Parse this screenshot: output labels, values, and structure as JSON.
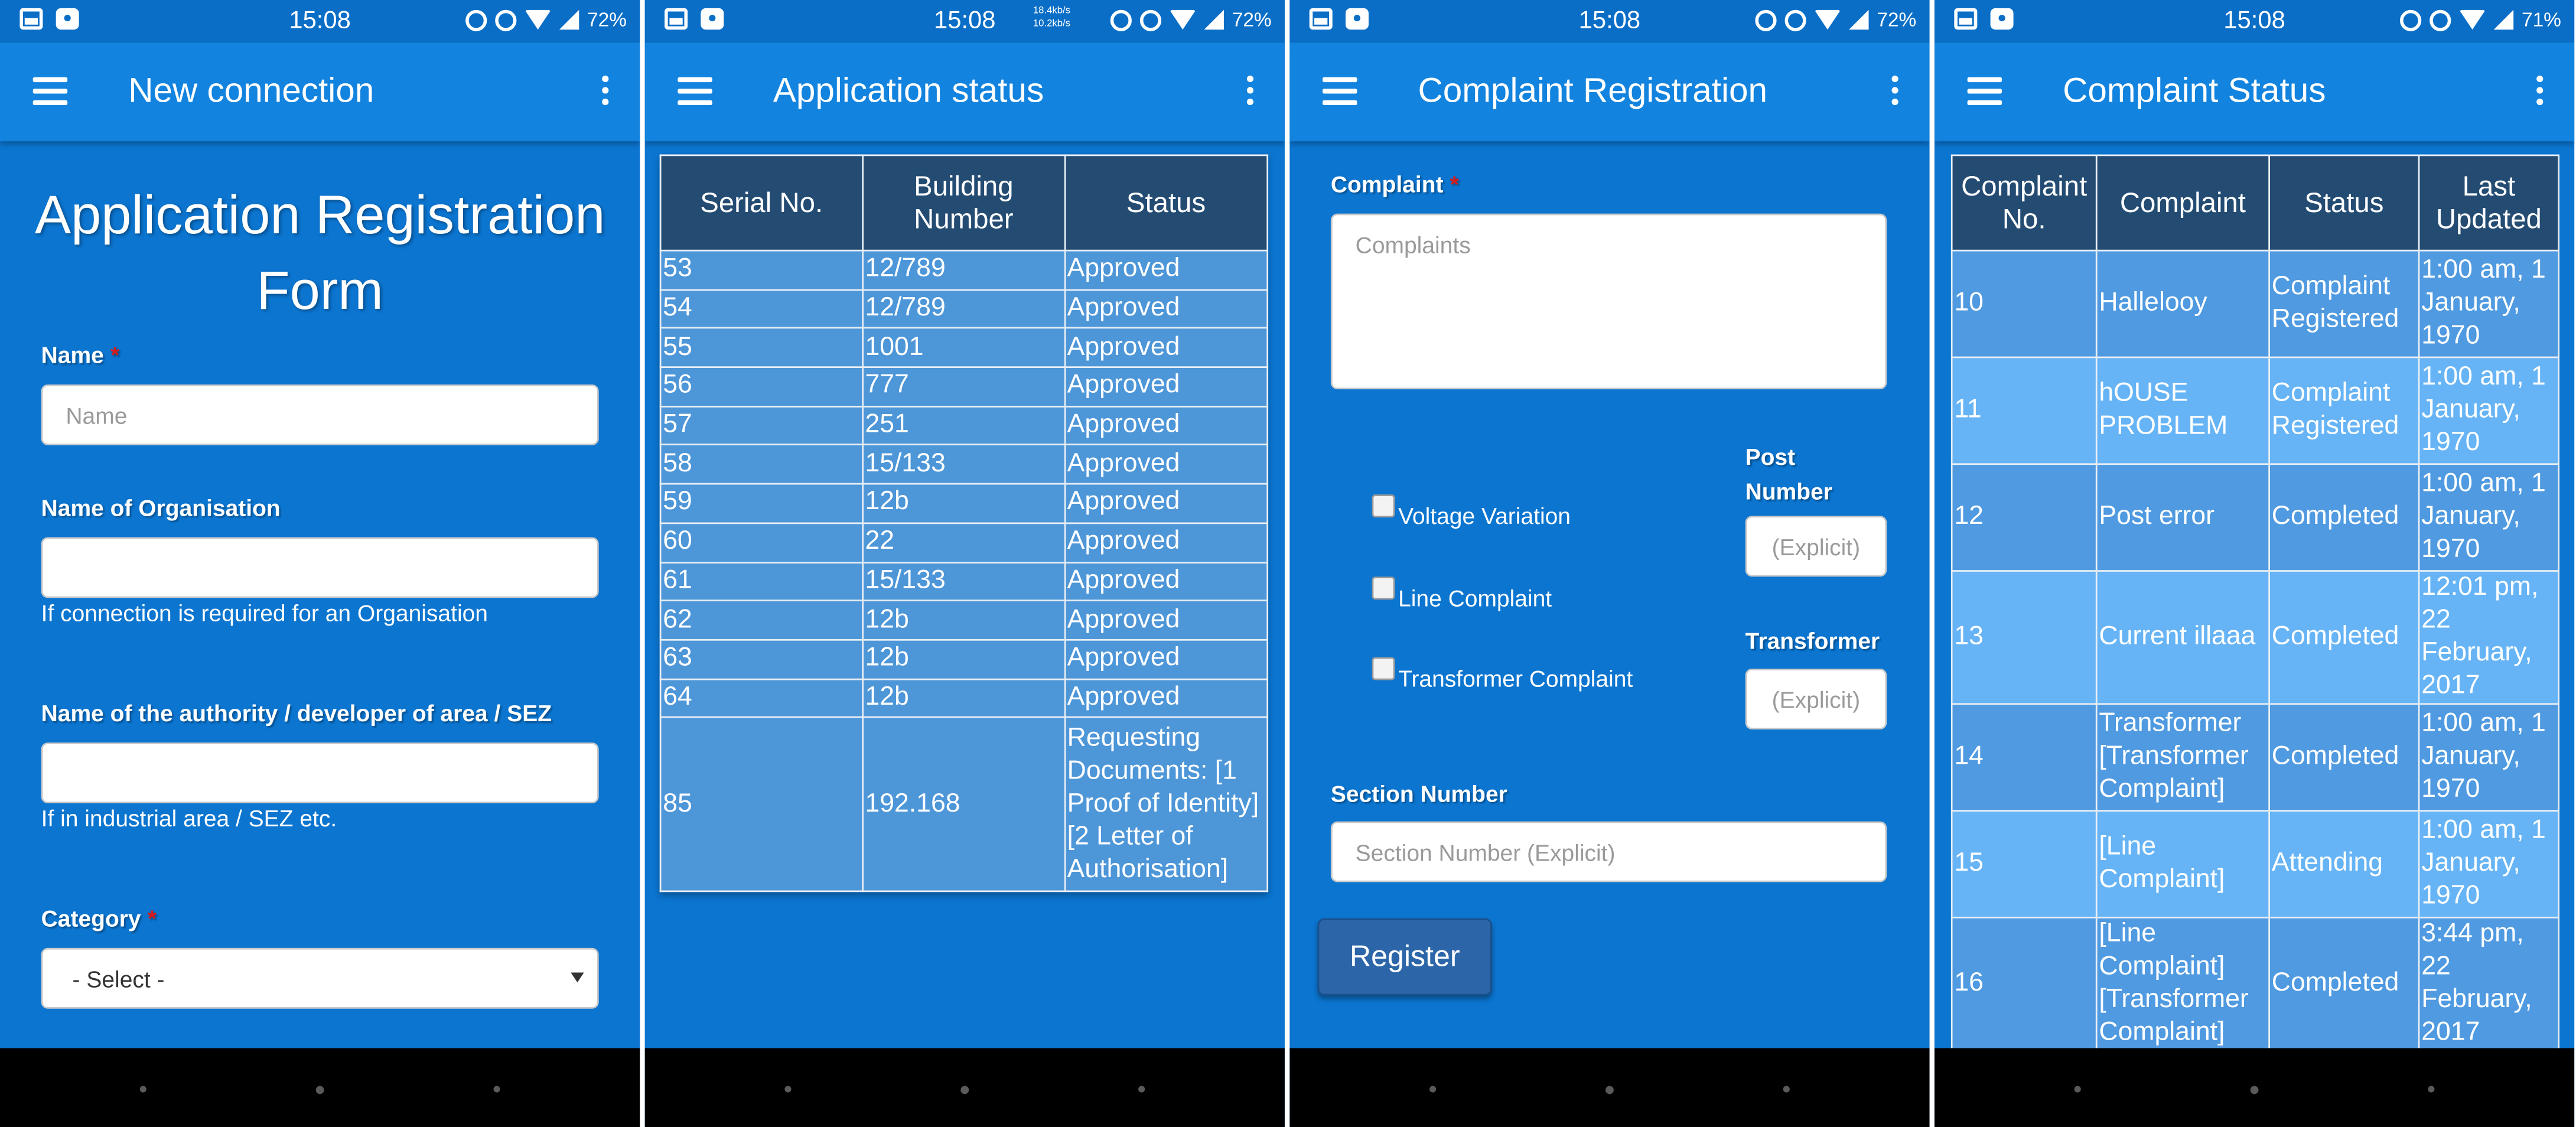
{
  "status_bar": [
    {
      "time": "15:08",
      "battery": "72%",
      "net_up": "",
      "net_down": ""
    },
    {
      "time": "15:08",
      "battery": "72%",
      "net_up": "18.4kb/s",
      "net_down": "10.2kb/s"
    },
    {
      "time": "15:08",
      "battery": "72%",
      "net_up": "",
      "net_down": ""
    },
    {
      "time": "15:08",
      "battery": "71%",
      "net_up": "",
      "net_down": ""
    }
  ],
  "new_connection": {
    "app_title": "New connection",
    "form_title": "Application Registration Form",
    "name_label": "Name",
    "name_placeholder": "Name",
    "organisation_label": "Name of Organisation",
    "organisation_help": "If connection is required for an Organisation",
    "authority_label": "Name of the authority / developer of area / SEZ",
    "authority_help": "If in industrial area / SEZ etc.",
    "category_label": "Category",
    "category_selected": "- Select -",
    "required_mark": "*"
  },
  "application_status": {
    "app_title": "Application status",
    "headers": [
      "Serial No.",
      "Building Number",
      "Status"
    ],
    "rows": [
      [
        "53",
        "12/789",
        "Approved"
      ],
      [
        "54",
        "12/789",
        "Approved"
      ],
      [
        "55",
        "1001",
        "Approved"
      ],
      [
        "56",
        "777",
        "Approved"
      ],
      [
        "57",
        "251",
        "Approved"
      ],
      [
        "58",
        "15/133",
        "Approved"
      ],
      [
        "59",
        "12b",
        "Approved"
      ],
      [
        "60",
        "22",
        "Approved"
      ],
      [
        "61",
        "15/133",
        "Approved"
      ],
      [
        "62",
        "12b",
        "Approved"
      ],
      [
        "63",
        "12b",
        "Approved"
      ],
      [
        "64",
        "12b",
        "Approved"
      ],
      [
        "85",
        "192.168",
        "Requesting Documents: [1 Proof of Identity] [2 Letter of Authorisation]"
      ]
    ]
  },
  "complaint_registration": {
    "app_title": "Complaint Registration",
    "complaint_label": "Complaint",
    "required_mark": "*",
    "complaint_placeholder": "Complaints",
    "options": [
      "Voltage Variation",
      "Line Complaint",
      "Transformer Complaint"
    ],
    "post_number_label": "Post Number",
    "post_number_placeholder": "(Explicit)",
    "transformer_label": "Transformer",
    "transformer_placeholder": "(Explicit)",
    "section_label": "Section Number",
    "section_placeholder": "Section Number (Explicit)",
    "register_button": "Register"
  },
  "complaint_status": {
    "app_title": "Complaint Status",
    "headers": [
      "Complaint No.",
      "Complaint",
      "Status",
      "Last Updated"
    ],
    "rows": [
      [
        "10",
        "Hallelooy",
        "Complaint Registered",
        "1:00 am, 1 January, 1970"
      ],
      [
        "11",
        "hOUSE PROBLEM",
        "Complaint Registered",
        "1:00 am, 1 January, 1970"
      ],
      [
        "12",
        "Post error",
        "Completed",
        "1:00 am, 1 January, 1970"
      ],
      [
        "13",
        "Current illaaa",
        "Completed",
        "12:01 pm, 22 February, 2017"
      ],
      [
        "14",
        "Transformer [Transformer Complaint]",
        "Completed",
        "1:00 am, 1 January, 1970"
      ],
      [
        "15",
        "[Line Complaint]",
        "Attending",
        "1:00 am, 1 January, 1970"
      ],
      [
        "16",
        "[Line Complaint] [Transformer Complaint]",
        "Completed",
        "3:44 pm, 22 February, 2017"
      ]
    ]
  }
}
